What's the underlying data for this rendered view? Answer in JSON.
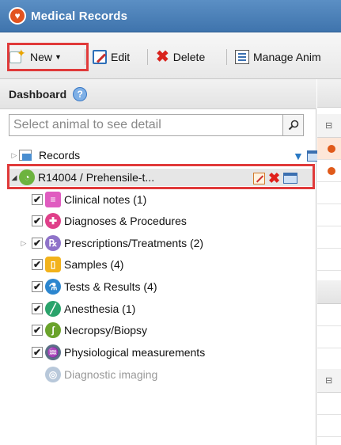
{
  "app": {
    "title": "Medical Records"
  },
  "toolbar": {
    "new_label": "New",
    "edit_label": "Edit",
    "delete_label": "Delete",
    "manage_label": "Manage Anim"
  },
  "dashboard": {
    "title": "Dashboard",
    "help_symbol": "?",
    "search_placeholder": "Select animal to see detail"
  },
  "tree": {
    "records_label": "Records",
    "animal_label": "R14004 / Prehensile-t...",
    "items": [
      {
        "label": "Clinical notes (1)",
        "icon": "clinical-notes-icon",
        "color": "#e05cc0",
        "checked": true
      },
      {
        "label": "Diagnoses & Procedures",
        "icon": "diagnoses-cross-icon",
        "color": "#e0408a",
        "checked": true
      },
      {
        "label": "Prescriptions/Treatments (2)",
        "icon": "prescription-rx-icon",
        "color": "#8f73c9",
        "checked": true
      },
      {
        "label": "Samples (4)",
        "icon": "samples-icon",
        "color": "#f2b21b",
        "checked": true
      },
      {
        "label": "Tests & Results (4)",
        "icon": "tests-results-icon",
        "color": "#2c86cf",
        "checked": true
      },
      {
        "label": "Anesthesia (1)",
        "icon": "anesthesia-syringe-icon",
        "color": "#2aa36b",
        "checked": true
      },
      {
        "label": "Necropsy/Biopsy",
        "icon": "necropsy-icon",
        "color": "#6aa32b",
        "checked": true
      },
      {
        "label": "Physiological measurements",
        "icon": "physiological-icon",
        "color": "#5a6f86",
        "checked": true
      },
      {
        "label": "Diagnostic imaging",
        "icon": "diagnostic-imaging-icon",
        "color": "#b8c8da",
        "checked": false,
        "disabled": true
      }
    ]
  },
  "right_panel": {
    "group_toggle_symbol": "⊟"
  }
}
